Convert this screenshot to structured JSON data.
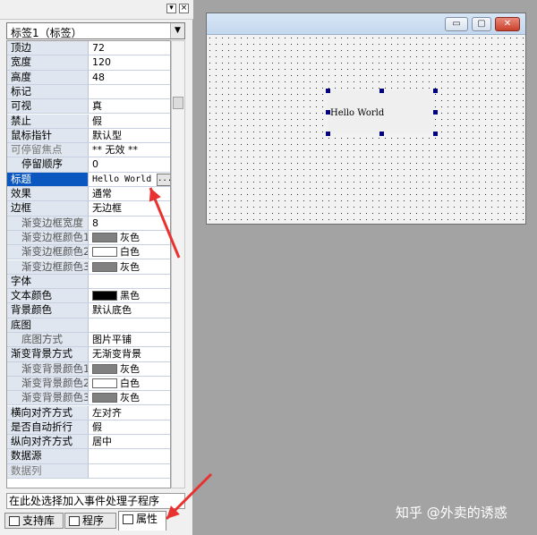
{
  "panel": {
    "object_select": "标签1（标签）",
    "title_btns": [
      "▾",
      "×"
    ],
    "event_prompt": "在此处选择加入事件处理子程序",
    "tabs": [
      {
        "label": "支持库"
      },
      {
        "label": "程序"
      },
      {
        "label": "属性"
      }
    ]
  },
  "properties": [
    {
      "name": "顶边",
      "value": "72",
      "style": "bold"
    },
    {
      "name": "宽度",
      "value": "120",
      "style": "bold"
    },
    {
      "name": "高度",
      "value": "48",
      "style": "bold"
    },
    {
      "name": "标记",
      "value": "",
      "style": "bold"
    },
    {
      "name": "可视",
      "value": "真",
      "style": "bold"
    },
    {
      "name": "禁止",
      "value": "假",
      "style": "bold"
    },
    {
      "name": "鼠标指针",
      "value": "默认型",
      "style": "bold"
    },
    {
      "name": "可停留焦点",
      "value": "** 无效 **",
      "style": "gray"
    },
    {
      "name": "停留顺序",
      "value": "0",
      "style": "sub-dark"
    },
    {
      "name": "标题",
      "value": "Hello World",
      "style": "selected"
    },
    {
      "name": "效果",
      "value": "通常",
      "style": "bold"
    },
    {
      "name": "边框",
      "value": "无边框",
      "style": "bold"
    },
    {
      "name": "渐变边框宽度",
      "value": "8",
      "style": "sub"
    },
    {
      "name": "渐变边框颜色1",
      "value": "灰色",
      "style": "sub",
      "swatch": "#808080"
    },
    {
      "name": "渐变边框颜色2",
      "value": "白色",
      "style": "sub",
      "swatch": "#ffffff"
    },
    {
      "name": "渐变边框颜色3",
      "value": "灰色",
      "style": "sub",
      "swatch": "#808080"
    },
    {
      "name": "字体",
      "value": "",
      "style": "bold"
    },
    {
      "name": "文本颜色",
      "value": "黑色",
      "style": "bold",
      "swatch": "#000000"
    },
    {
      "name": "背景颜色",
      "value": "默认底色",
      "style": "bold"
    },
    {
      "name": "底图",
      "value": "",
      "style": "bold"
    },
    {
      "name": "底图方式",
      "value": "图片平铺",
      "style": "sub"
    },
    {
      "name": "渐变背景方式",
      "value": "无渐变背景",
      "style": "bold"
    },
    {
      "name": "渐变背景颜色1",
      "value": "灰色",
      "style": "sub",
      "swatch": "#808080"
    },
    {
      "name": "渐变背景颜色2",
      "value": "白色",
      "style": "sub",
      "swatch": "#ffffff"
    },
    {
      "name": "渐变背景颜色3",
      "value": "灰色",
      "style": "sub",
      "swatch": "#808080"
    },
    {
      "name": "横向对齐方式",
      "value": "左对齐",
      "style": "bold"
    },
    {
      "name": "是否自动折行",
      "value": "假",
      "style": "bold"
    },
    {
      "name": "纵向对齐方式",
      "value": "居中",
      "style": "bold"
    },
    {
      "name": "数据源",
      "value": "",
      "style": "bold"
    },
    {
      "name": "数据列",
      "value": "",
      "style": "gray"
    }
  ],
  "ellipsis": "...",
  "designer": {
    "btn_min": "▭",
    "btn_max": "▢",
    "btn_close": "✕",
    "label_text": "Hello World"
  },
  "watermark": "知乎 @外卖的诱惑",
  "colors": {
    "selected_row": "#0a57c0",
    "annotation_arrow": "#e8322f"
  }
}
